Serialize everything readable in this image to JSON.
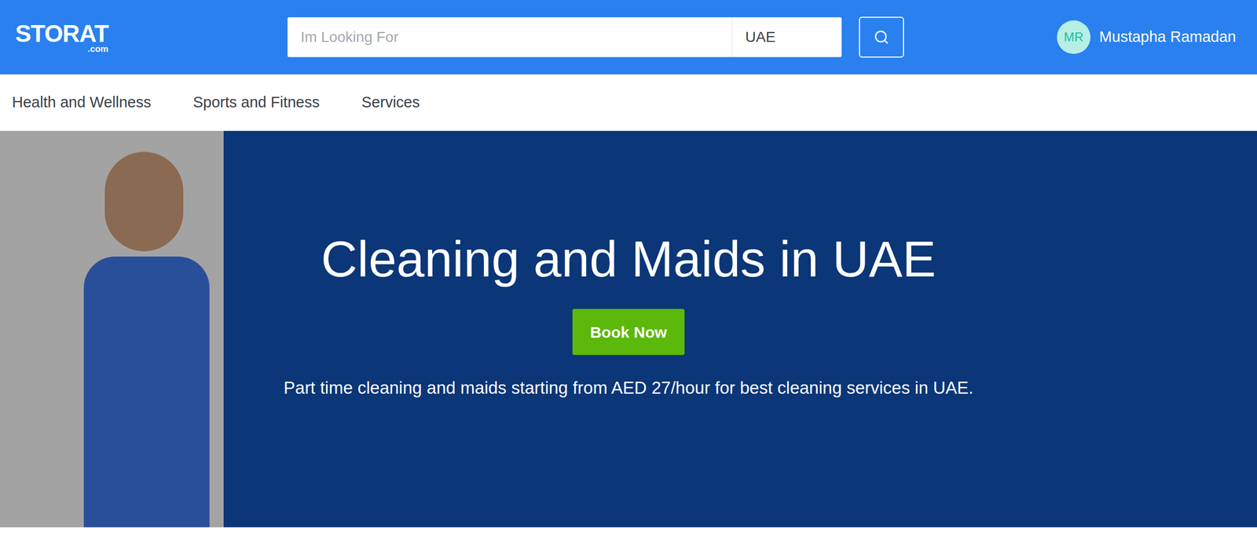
{
  "header": {
    "logo": {
      "name": "STORAT",
      "suffix": ".com"
    },
    "search": {
      "placeholder": "Im Looking For",
      "location": "UAE"
    },
    "user": {
      "initials": "MR",
      "name": "Mustapha Ramadan"
    }
  },
  "nav": {
    "items": [
      {
        "label": "Health and Wellness"
      },
      {
        "label": "Sports and Fitness"
      },
      {
        "label": "Services"
      }
    ]
  },
  "hero": {
    "title": "Cleaning and Maids in UAE",
    "button": "Book Now",
    "subtitle": "Part time cleaning and maids starting from AED 27/hour for best cleaning services in UAE."
  }
}
